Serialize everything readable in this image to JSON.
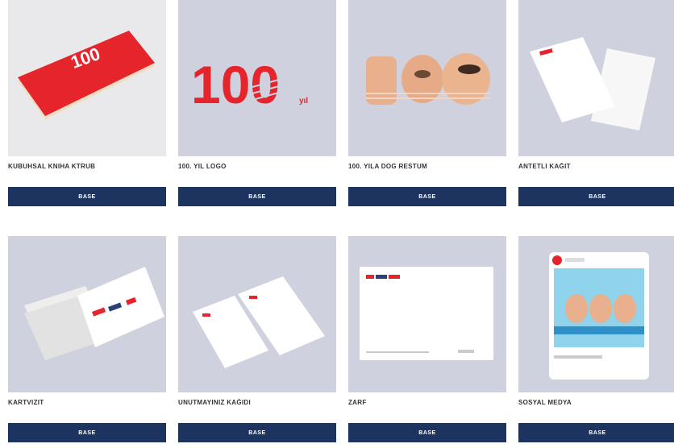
{
  "cards": [
    {
      "caption": "KUBUHSAL KNIHA KTRUB",
      "button": "BASE",
      "icon": "red-book-mockup"
    },
    {
      "caption": "100. YIL LOGO",
      "button": "BASE",
      "icon": "striped-100-logo"
    },
    {
      "caption": "100. YILA DOG RESTUM",
      "button": "BASE",
      "icon": "100-eyes-photo"
    },
    {
      "caption": "ANTETLI KAĞIT",
      "button": "BASE",
      "icon": "letterhead-mockup"
    },
    {
      "caption": "KARTVIZIT",
      "button": "BASE",
      "icon": "business-card-stack"
    },
    {
      "caption": "UNUTMAYINIZ KAĞIDI",
      "button": "BASE",
      "icon": "notepad-cards"
    },
    {
      "caption": "ZARF",
      "button": "BASE",
      "icon": "envelope-mockup"
    },
    {
      "caption": "SOSYAL MEDYA",
      "button": "BASE",
      "icon": "social-post-mockup"
    }
  ],
  "brand": {
    "red": "#e5242c",
    "navy": "#1d3461",
    "tile": "#cfd2de"
  },
  "art": {
    "logo_text": "100",
    "logo_suffix": "yıl"
  }
}
